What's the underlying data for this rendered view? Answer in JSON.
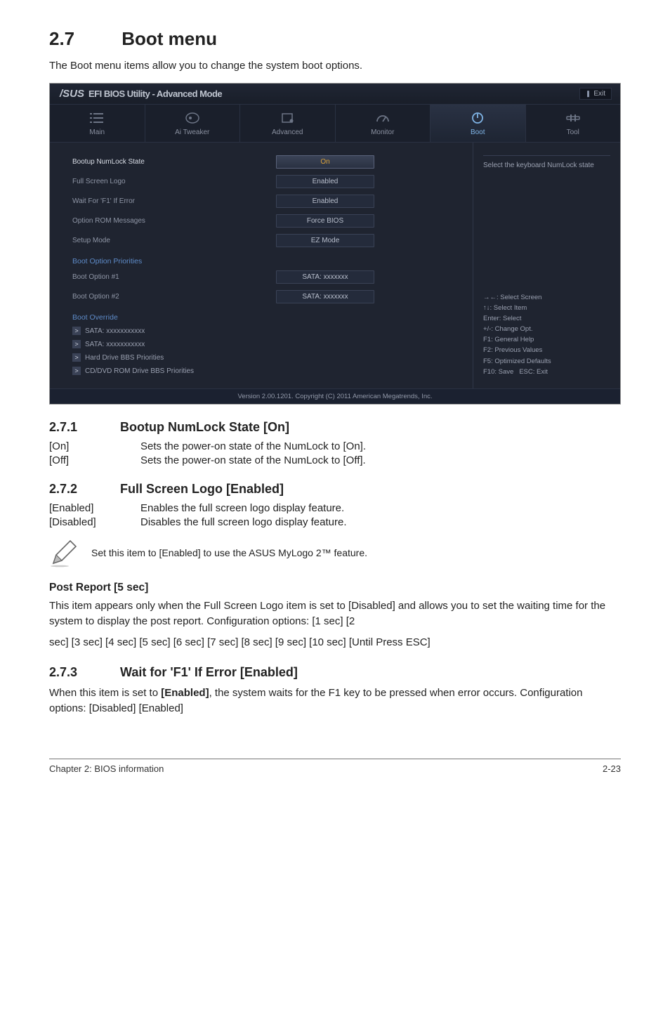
{
  "section": {
    "num": "2.7",
    "title": "Boot menu"
  },
  "intro": "The Boot menu items allow you to change the system boot options.",
  "bios": {
    "brand": "/SUS",
    "header_title": "EFI BIOS Utility - Advanced Mode",
    "exit": "Exit",
    "tabs": [
      {
        "label": "Main"
      },
      {
        "label": "Ai  Tweaker"
      },
      {
        "label": "Advanced"
      },
      {
        "label": "Monitor"
      },
      {
        "label": "Boot"
      },
      {
        "label": "Tool"
      }
    ],
    "rows": {
      "numlock_label": "Bootup NumLock State",
      "numlock_val": "On",
      "logo_label": "Full Screen Logo",
      "logo_val": "Enabled",
      "wait_label": "Wait For 'F1' If Error",
      "wait_val": "Enabled",
      "orom_label": "Option ROM Messages",
      "orom_val": "Force BIOS",
      "setup_label": "Setup Mode",
      "setup_val": "EZ Mode"
    },
    "boot_priorities": {
      "head": "Boot Option Priorities",
      "opt1_label": "Boot Option #1",
      "opt1_val": "SATA: xxxxxxx",
      "opt2_label": "Boot Option #2",
      "opt2_val": "SATA: xxxxxxx"
    },
    "override": {
      "head": "Boot Override",
      "items": [
        "SATA: xxxxxxxxxxx",
        "SATA: xxxxxxxxxxx",
        "Hard Drive BBS Priorities",
        "CD/DVD ROM Drive BBS Priorities"
      ]
    },
    "help_top": "Select the keyboard NumLock state",
    "help_keys": [
      "→←: Select Screen",
      "↑↓: Select Item",
      "Enter: Select",
      "+/-: Change Opt.",
      "F1: General Help",
      "F2: Previous Values",
      "F5: Optimized Defaults",
      "F10: Save   ESC: Exit"
    ],
    "footer": "Version 2.00.1201.  Copyright (C) 2011 American Megatrends, Inc."
  },
  "sub271": {
    "num": "2.7.1",
    "title": "Bootup NumLock State [On]",
    "on_key": "[On]",
    "on_desc": "Sets the power-on state of the NumLock to [On].",
    "off_key": "[Off]",
    "off_desc": "Sets the power-on state of the NumLock to [Off]."
  },
  "sub272": {
    "num": "2.7.2",
    "title": "Full Screen Logo [Enabled]",
    "en_key": "[Enabled]",
    "en_desc": "Enables the full screen logo display feature.",
    "dis_key": "[Disabled]",
    "dis_desc": "Disables the full screen logo display feature.",
    "note": "Set this item to [Enabled] to use the ASUS MyLogo 2™ feature."
  },
  "post_report": {
    "head": "Post Report [5 sec]",
    "body1": "This item appears only when the Full Screen Logo item is set to [Disabled] and allows you to set the waiting time for the system to display the post report. Configuration options: [1 sec] [2",
    "body2": "sec] [3 sec] [4 sec] [5 sec] [6 sec] [7 sec] [8 sec] [9 sec] [10 sec] [Until Press ESC]"
  },
  "sub273": {
    "num": "2.7.3",
    "title": "Wait for 'F1' If Error [Enabled]",
    "body_pre": "When this item is set to ",
    "body_bold": "[Enabled]",
    "body_post": ", the system waits for the F1 key to be pressed when error occurs. Configuration options: [Disabled] [Enabled]"
  },
  "footer": {
    "left": "Chapter 2: BIOS information",
    "right": "2-23"
  }
}
